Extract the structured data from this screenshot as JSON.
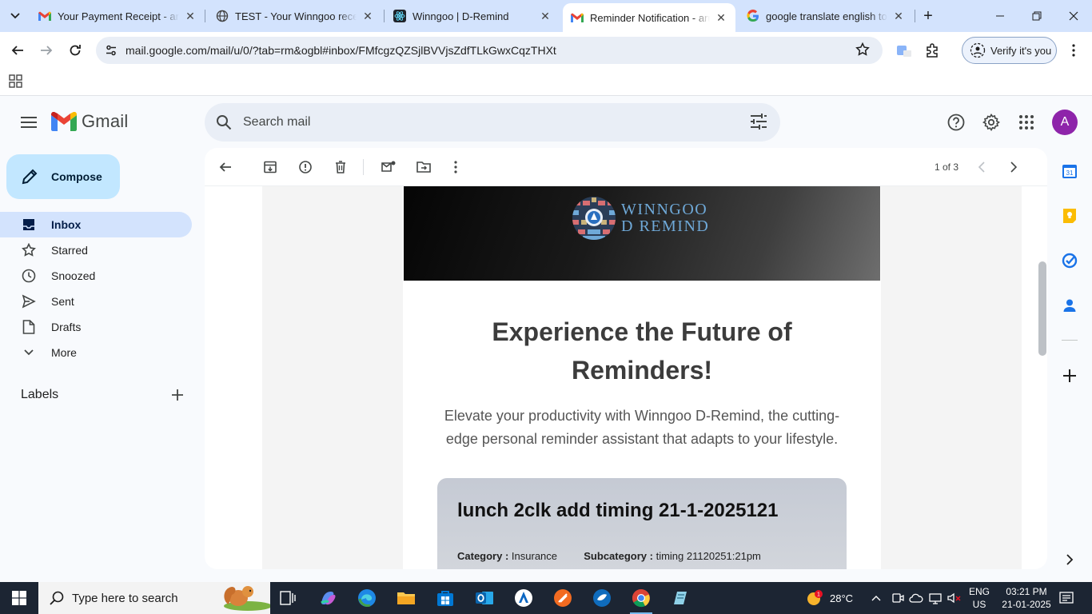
{
  "browser": {
    "tabs": [
      {
        "title": "Your Payment Receipt - arun",
        "favicon": "gmail-icon"
      },
      {
        "title": "TEST - Your Winngoo receipt",
        "favicon": "globe-icon"
      },
      {
        "title": "Winngoo | D-Remind",
        "favicon": "react-icon"
      },
      {
        "title": "Reminder Notification - arun",
        "favicon": "gmail-icon",
        "active": true
      },
      {
        "title": "google translate english to t",
        "favicon": "google-icon"
      }
    ],
    "url": "mail.google.com/mail/u/0/?tab=rm&ogbl#inbox/FMfcgzQZSjlBVVjsZdfTLkGwxCqzTHXt",
    "verify_label": "Verify it's you"
  },
  "gmail": {
    "logo_text": "Gmail",
    "search_placeholder": "Search mail",
    "avatar_letter": "A",
    "avatar_color": "#8e24aa",
    "compose_label": "Compose",
    "nav": [
      {
        "label": "Inbox",
        "icon": "inbox-icon",
        "active": true
      },
      {
        "label": "Starred",
        "icon": "star-icon"
      },
      {
        "label": "Snoozed",
        "icon": "clock-icon"
      },
      {
        "label": "Sent",
        "icon": "send-icon"
      },
      {
        "label": "Drafts",
        "icon": "draft-icon"
      },
      {
        "label": "More",
        "icon": "chevron-down-icon"
      }
    ],
    "labels_heading": "Labels",
    "pager_text": "1 of 3"
  },
  "email": {
    "brand_line1": "WINNGOO",
    "brand_line2": "D REMIND",
    "headline_line1": "Experience the Future of",
    "headline_line2": "Reminders!",
    "intro": "Elevate your productivity with Winngoo D-Remind, the cutting-edge personal reminder assistant that adapts to your lifestyle.",
    "card": {
      "title": "lunch 2clk add timing 21-1-2025121",
      "category_label": "Category :",
      "category_value": "Insurance",
      "subcategory_label": "Subcategory :",
      "subcategory_value": "timing 21120251:21pm"
    }
  },
  "taskbar": {
    "search_placeholder": "Type here to search",
    "weather": "28°C",
    "lang_top": "ENG",
    "lang_bottom": "US",
    "time": "03:21 PM",
    "date": "21-01-2025"
  }
}
